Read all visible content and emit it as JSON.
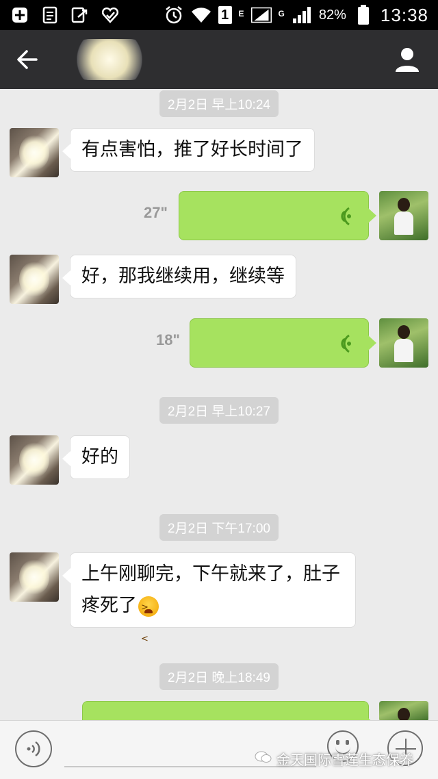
{
  "status_bar": {
    "icons": [
      "plus-box-icon",
      "notes-icon",
      "export-icon",
      "heart-check-icon",
      "alarm-icon",
      "wifi-icon"
    ],
    "sim_label": "1",
    "network_type_1": "E",
    "network_type_2": "G",
    "battery": "82%",
    "time": "13:38"
  },
  "title_bar": {
    "back_icon": "arrow-left-icon",
    "profile_icon": "person-icon"
  },
  "messages": [
    {
      "kind": "timestamp",
      "text": "2月2日 早上10:24"
    },
    {
      "kind": "text",
      "from": "other",
      "text": "有点害怕，推了好长时间了"
    },
    {
      "kind": "voice",
      "from": "me",
      "duration": "27\""
    },
    {
      "kind": "text",
      "from": "other",
      "text": "好，那我继续用，继续等"
    },
    {
      "kind": "voice",
      "from": "me",
      "duration": "18\""
    },
    {
      "kind": "timestamp",
      "text": "2月2日 早上10:27"
    },
    {
      "kind": "text",
      "from": "other",
      "text": "好的"
    },
    {
      "kind": "timestamp",
      "text": "2月2日 下午17:00"
    },
    {
      "kind": "text",
      "from": "other",
      "line1": "上午刚聊完，下午就来了，肚子",
      "line2": "疼死了"
    },
    {
      "kind": "timestamp",
      "text": "2月2日 晚上18:49"
    }
  ],
  "input_bar": {
    "voice_icon": "voice-toggle-icon",
    "emoji_icon": "smiley-icon",
    "plus_icon": "plus-icon",
    "watermark": "金天国际雪莲生态保养"
  },
  "colors": {
    "status_bar_bg": "#000000",
    "title_bar_bg": "#2e2e30",
    "chat_bg": "#ebebeb",
    "sent_bubble": "#a6e25f",
    "received_bubble": "#ffffff",
    "timestamp_bg": "#d3d3d3"
  }
}
